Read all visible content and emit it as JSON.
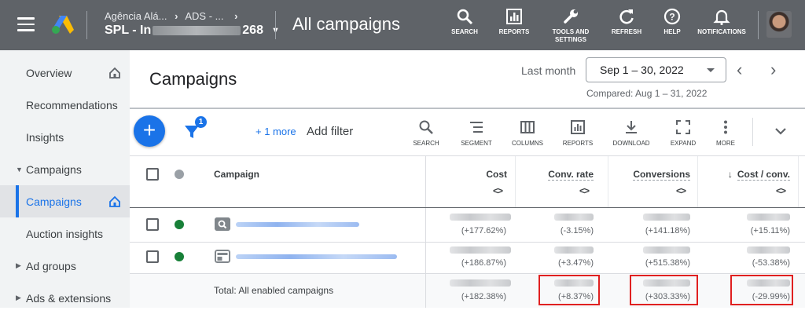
{
  "topbar": {
    "account_line1": "Agência Alá...",
    "account_line2_prefix": "ADS - ...",
    "account_name_start": "SPL - In",
    "account_name_end": "268",
    "page_title": "All campaigns",
    "buttons": [
      {
        "label": "SEARCH",
        "icon": "search-icon"
      },
      {
        "label": "REPORTS",
        "icon": "reports-icon"
      },
      {
        "label": "TOOLS AND SETTINGS",
        "icon": "wrench-icon"
      },
      {
        "label": "REFRESH",
        "icon": "refresh-icon"
      },
      {
        "label": "HELP",
        "icon": "help-icon"
      },
      {
        "label": "NOTIFICATIONS",
        "icon": "bell-icon"
      }
    ]
  },
  "sidebar": {
    "items": [
      {
        "label": "Overview"
      },
      {
        "label": "Recommendations"
      },
      {
        "label": "Insights"
      },
      {
        "label": "Campaigns"
      },
      {
        "label": "Campaigns"
      },
      {
        "label": "Auction insights"
      },
      {
        "label": "Ad groups"
      },
      {
        "label": "Ads & extensions"
      }
    ]
  },
  "header": {
    "title": "Campaigns",
    "range_label": "Last month",
    "date_range": "Sep 1 – 30, 2022",
    "compared": "Compared: Aug 1 – 31, 2022"
  },
  "toolbar": {
    "filter_count": "1",
    "more_link": "+ 1 more",
    "add_filter": "Add filter",
    "tools": [
      "SEARCH",
      "SEGMENT",
      "COLUMNS",
      "REPORTS",
      "DOWNLOAD",
      "EXPAND",
      "MORE"
    ]
  },
  "table": {
    "columns": [
      "Campaign",
      "Cost",
      "Conv. rate",
      "Conversions",
      "Cost / conv."
    ],
    "sort_arrow": "↓",
    "expand_glyph": "<>",
    "rows": [
      {
        "type": "search",
        "cost_change": "(+177.62%)",
        "conv_rate_change": "(-3.15%)",
        "conversions_change": "(+141.18%)",
        "cost_conv_change": "(+15.11%)"
      },
      {
        "type": "display",
        "cost_change": "(+186.87%)",
        "conv_rate_change": "(+3.47%)",
        "conversions_change": "(+515.38%)",
        "cost_conv_change": "(-53.38%)"
      }
    ],
    "total": {
      "label": "Total: All enabled campaigns",
      "cost_change": "(+182.38%)",
      "conv_rate_change": "(+8.37%)",
      "conversions_change": "(+303.33%)",
      "cost_conv_change": "(-29.99%)"
    }
  },
  "colors": {
    "topbar": "#5f6368",
    "accent": "#1a73e8",
    "status_enabled": "#188038",
    "highlight_box": "#e02020"
  }
}
